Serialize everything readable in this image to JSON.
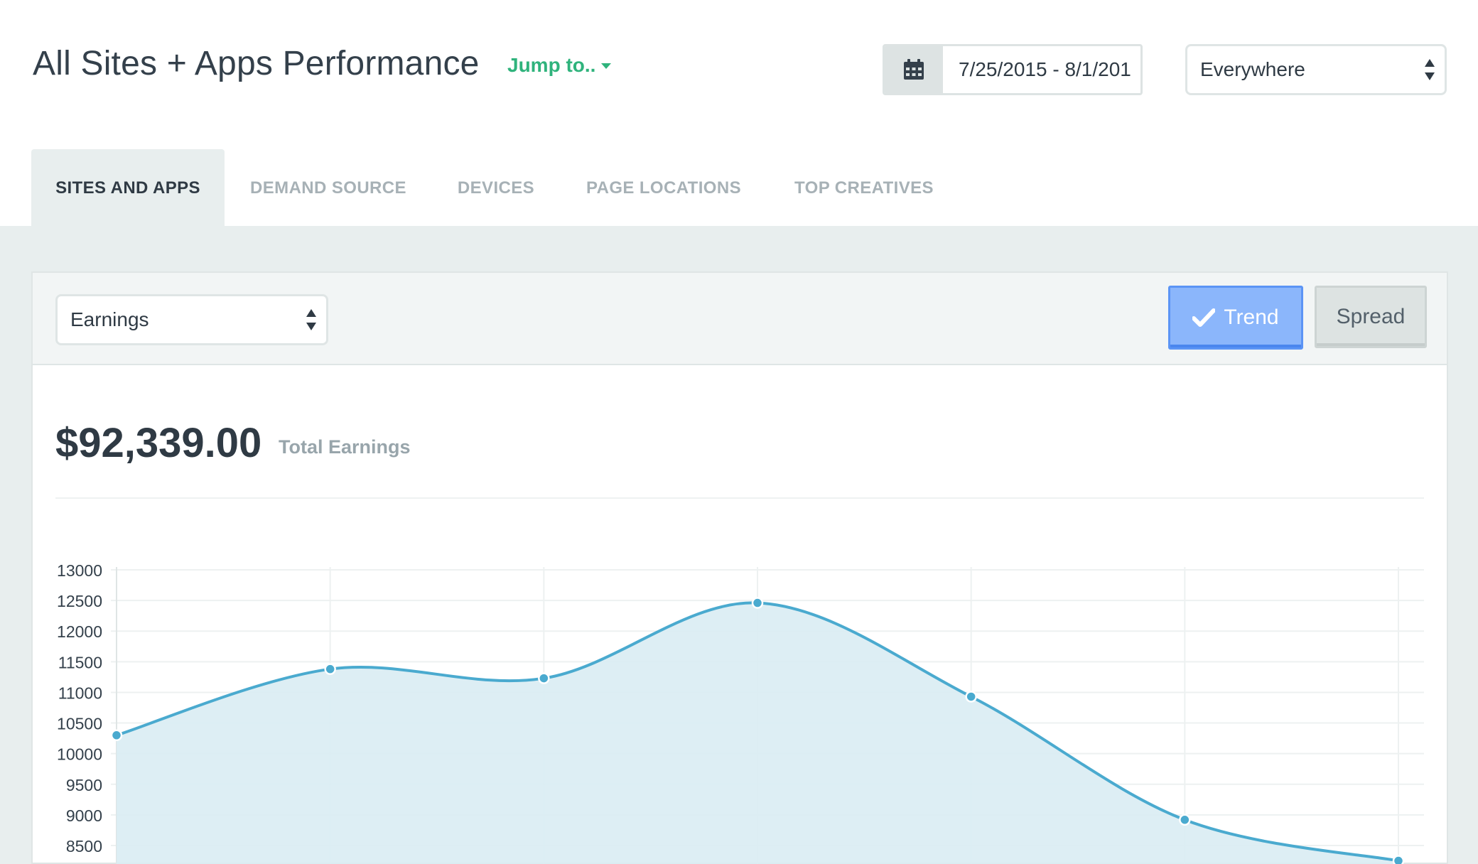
{
  "header": {
    "title": "All Sites + Apps Performance",
    "jump_label": "Jump to..",
    "date_range": "7/25/2015 - 8/1/201",
    "location_select": "Everywhere"
  },
  "tabs": [
    {
      "label": "SITES AND APPS",
      "active": true
    },
    {
      "label": "DEMAND SOURCE",
      "active": false
    },
    {
      "label": "DEVICES",
      "active": false
    },
    {
      "label": "PAGE LOCATIONS",
      "active": false
    },
    {
      "label": "TOP CREATIVES",
      "active": false
    }
  ],
  "panel": {
    "metric_select": "Earnings",
    "trend_label": "Trend",
    "spread_label": "Spread",
    "total_value": "$92,339.00",
    "total_label": "Total Earnings"
  },
  "colors": {
    "accent_green": "#2fb37c",
    "trend_blue": "#8bb6fb",
    "line_blue": "#4aaacf",
    "fill_blue": "#d9ecf3"
  },
  "icons": {
    "calendar": "calendar-icon",
    "jump_caret": "caret-down-icon",
    "select_arrows": "select-arrows-icon",
    "trend_check": "checkmark-icon"
  },
  "chart_data": {
    "type": "area",
    "y_ticks": [
      "13000",
      "12500",
      "12000",
      "11500",
      "11000",
      "10500",
      "10000",
      "9500",
      "9000",
      "8500"
    ],
    "ylim": [
      8500,
      13000
    ],
    "grid": true,
    "series": [
      {
        "values": [
          10300,
          11380,
          11230,
          12460,
          10930,
          8920,
          8250
        ]
      }
    ]
  }
}
